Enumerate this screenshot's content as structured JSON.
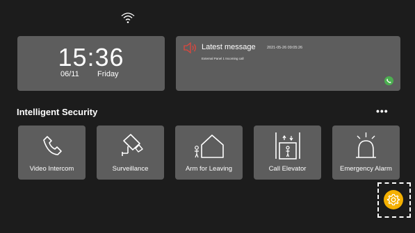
{
  "status": {
    "wifi_icon": "wifi-icon"
  },
  "clock": {
    "time": "15:36",
    "date": "06/11",
    "day": "Friday"
  },
  "message": {
    "title": "Latest message",
    "timestamp": "2021-05-26  09:05:26",
    "detail": "External Panel 1 Incoming call",
    "speaker_icon": "speaker-icon",
    "call_icon": "phone-icon",
    "colors": {
      "speaker": "#e0463c",
      "call": "#4caf50"
    }
  },
  "section": {
    "title": "Intelligent Security",
    "more_label": "•••"
  },
  "tiles": [
    {
      "label": "Video Intercom",
      "icon": "phone-handset-icon"
    },
    {
      "label": "Surveillance",
      "icon": "camera-icon"
    },
    {
      "label": "Arm for Leaving",
      "icon": "house-person-icon"
    },
    {
      "label": "Call Elevator",
      "icon": "elevator-icon"
    },
    {
      "label": "Emergency Alarm",
      "icon": "alarm-icon"
    }
  ],
  "settings": {
    "icon": "gear-icon",
    "color": "#f4b000"
  }
}
